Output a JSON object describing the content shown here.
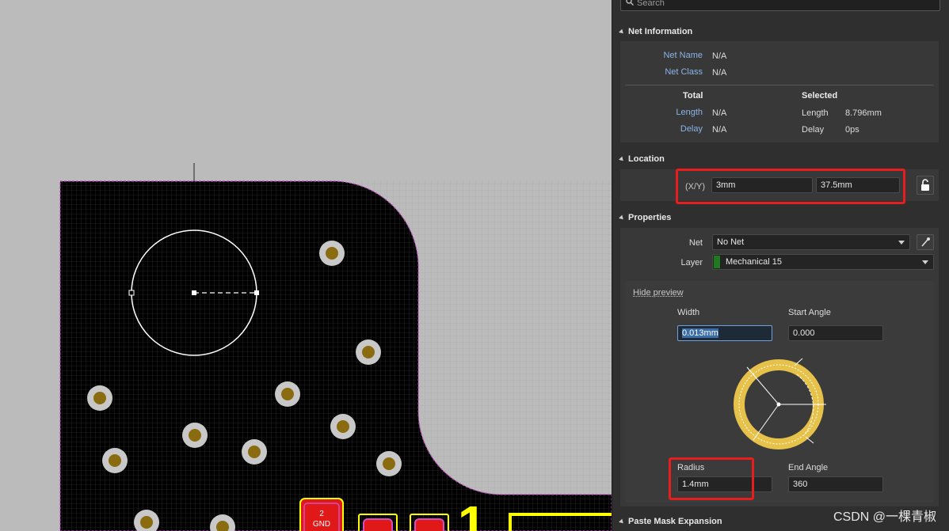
{
  "search": {
    "placeholder": "Search"
  },
  "net_info": {
    "title": "Net Information",
    "net_name_label": "Net Name",
    "net_name_value": "N/A",
    "net_class_label": "Net Class",
    "net_class_value": "N/A",
    "total_header": "Total",
    "selected_header": "Selected",
    "length_label": "Length",
    "total_length": "N/A",
    "selected_length_label": "Length",
    "selected_length": "8.796mm",
    "delay_label": "Delay",
    "total_delay": "N/A",
    "selected_delay_label": "Delay",
    "selected_delay": "0ps"
  },
  "location": {
    "title": "Location",
    "xy_label": "(X/Y)",
    "x": "3mm",
    "y": "37.5mm",
    "lock_icon": "unlock-icon"
  },
  "properties": {
    "title": "Properties",
    "net_label": "Net",
    "net_value": "No Net",
    "picker_icon": "eyedropper-icon",
    "layer_label": "Layer",
    "layer_value": "Mechanical 15",
    "layer_color": "#1f7a1f",
    "hide_preview": "Hide preview",
    "width_label": "Width",
    "width_value": "0.013mm",
    "start_angle_label": "Start Angle",
    "start_angle_value": "0.000",
    "radius_label": "Radius",
    "radius_value": "1.4mm",
    "end_angle_label": "End Angle",
    "end_angle_value": "360"
  },
  "paste_mask": {
    "title": "Paste Mask Expansion"
  },
  "pcb": {
    "pad_number": "2",
    "pad_net": "GND",
    "designator": "1"
  },
  "watermark": "CSDN @一棵青椒",
  "colors": {
    "highlight": "#e81e1e",
    "arc_preview": "#e6c24a",
    "board": "#000000",
    "board_edge": "#c040c0",
    "silkscreen": "#ffff00"
  }
}
